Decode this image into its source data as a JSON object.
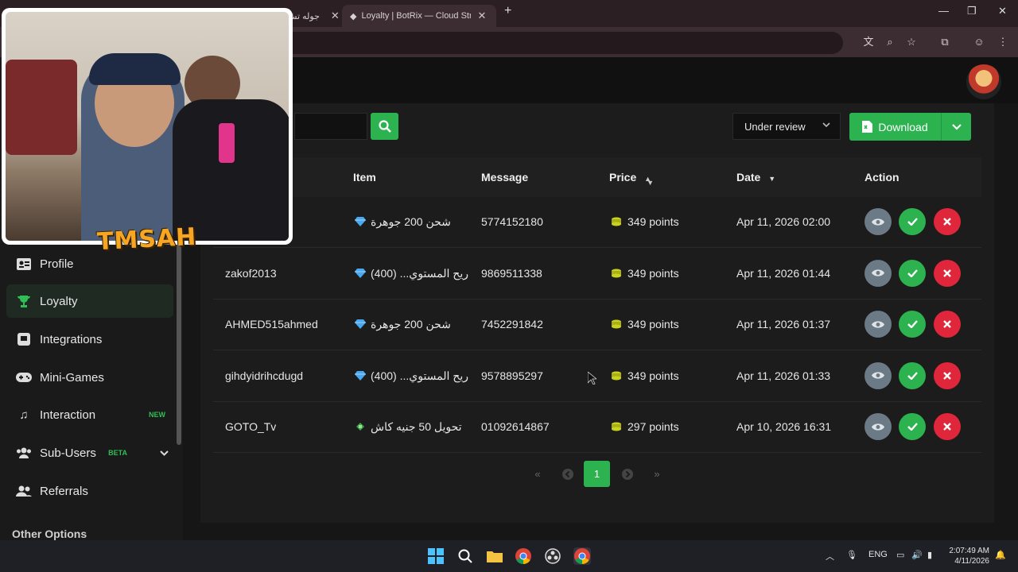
{
  "browser": {
    "tabs": [
      {
        "title": "جوله تش",
        "active": false
      },
      {
        "title": "Loyalty | BotRix — Cloud Strean",
        "active": true
      }
    ]
  },
  "toolbar": {
    "search_placeholder": "",
    "status_filter": "Under review",
    "download_label": "Download"
  },
  "sidebar": {
    "items": [
      {
        "label": "Profile",
        "icon": "id-card-icon",
        "badge": ""
      },
      {
        "label": "Loyalty",
        "icon": "trophy-icon",
        "badge": "",
        "active": true
      },
      {
        "label": "Integrations",
        "icon": "integrations-icon",
        "badge": ""
      },
      {
        "label": "Mini-Games",
        "icon": "gamepad-icon",
        "badge": ""
      },
      {
        "label": "Interaction",
        "icon": "music-icon",
        "badge": "NEW"
      },
      {
        "label": "Sub-Users",
        "icon": "users-icon",
        "badge": "BETA"
      },
      {
        "label": "Referrals",
        "icon": "user-group-icon",
        "badge": ""
      }
    ],
    "other_options": "Other Options"
  },
  "table": {
    "headers": {
      "item": "Item",
      "message": "Message",
      "price": "Price",
      "date": "Date",
      "action": "Action"
    },
    "rows": [
      {
        "user": "",
        "item": "شحن 200 جوهرة",
        "item_icon": "gem-icon",
        "message": "5774152180",
        "price": "349 points",
        "date": "Apr 11, 2026 02:00"
      },
      {
        "user": "zakof2013",
        "item": "(400) ...ريح المستوي",
        "item_icon": "gem-icon",
        "message": "9869511338",
        "price": "349 points",
        "date": "Apr 11, 2026 01:44"
      },
      {
        "user": "AHMED515ahmed",
        "item": "شحن 200 جوهرة",
        "item_icon": "gem-icon",
        "message": "7452291842",
        "price": "349 points",
        "date": "Apr 11, 2026 01:37"
      },
      {
        "user": "gihdyidrihcdugd",
        "item": "(400) ...ريح المستوي",
        "item_icon": "gem-icon",
        "message": "9578895297",
        "price": "349 points",
        "date": "Apr 11, 2026 01:33"
      },
      {
        "user": "GOTO_Tv",
        "item": "تحويل 50 جنيه كاش",
        "item_icon": "money-icon",
        "message": "01092614867",
        "price": "297 points",
        "date": "Apr 10, 2026 16:31"
      }
    ]
  },
  "pagination": {
    "current": "1"
  },
  "overlay": {
    "logo_text": "TMSAH"
  },
  "system": {
    "lang": "ENG",
    "time": "2:07:49 AM",
    "date": "4/11/2026"
  },
  "colors": {
    "accent": "#2cb34f",
    "danger": "#e0263b",
    "view": "#6c7a86"
  }
}
